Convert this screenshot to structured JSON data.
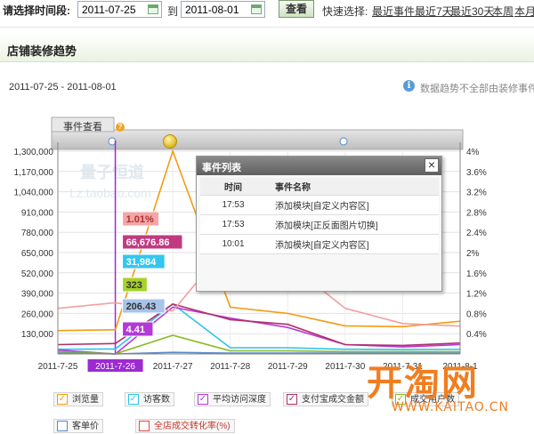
{
  "filter": {
    "label": "请选择时间段:",
    "start_date": "2011-07-25",
    "to_label": "到",
    "end_date": "2011-08-01",
    "query_button": "查看",
    "quick_label": "快速选择:",
    "quick_links": [
      "最近事件",
      "最近7天",
      "最近30天",
      "本周",
      "本月"
    ]
  },
  "panel": {
    "title": "店铺装修趋势",
    "date_range": "2011-07-25 - 2011-08-01",
    "note": "数据趋势不全部由装修事件"
  },
  "event_bar": {
    "label": "事件查看"
  },
  "watermark": {
    "text": "量子恒道",
    "url": "Lz.taobao.com"
  },
  "popup": {
    "title": "事件列表",
    "col_time": "时间",
    "col_name": "事件名称",
    "rows": [
      {
        "time": "17:53",
        "name": "添加模块[自定义内容区]"
      },
      {
        "time": "17:53",
        "name": "添加模块[正反面图片切换]"
      },
      {
        "time": "10:01",
        "name": "添加模块[自定义内容区]"
      }
    ]
  },
  "chart_data": {
    "type": "line",
    "x": [
      "2011-7-25",
      "2011-7-26",
      "2011-7-27",
      "2011-7-28",
      "2011-7-29",
      "2011-7-30",
      "2011-7-31",
      "2011-8-1"
    ],
    "selected_x": "2011-7-26",
    "ylim_left": [
      0,
      1300000
    ],
    "yticks_left": [
      "1,300,000",
      "1,170,000",
      "1,040,000",
      "910,000",
      "780,000",
      "650,000",
      "520,000",
      "390,000",
      "260,000",
      "130,000"
    ],
    "ylim_right": [
      0,
      4
    ],
    "yticks_right": [
      "4%",
      "3.6%",
      "3.2%",
      "2.8%",
      "2.4%",
      "2%",
      "1.6%",
      "1.2%",
      "0.8%",
      "0.4%"
    ],
    "series": [
      {
        "name": "浏览量",
        "color": "#f39c12",
        "axis": "left",
        "values": [
          150000,
          155000,
          1300000,
          300000,
          260000,
          180000,
          175000,
          210000
        ]
      },
      {
        "name": "访客数",
        "color": "#2ec4e6",
        "axis": "left",
        "values": [
          30000,
          31984,
          320000,
          40000,
          40000,
          30000,
          28000,
          30000
        ]
      },
      {
        "name": "平均访问深度",
        "color": "#b73ad6",
        "axis": "left",
        "values": [
          25000,
          4.41,
          300000,
          230000,
          170000,
          60000,
          45000,
          60000
        ]
      },
      {
        "name": "支付宝成交金额",
        "color": "#b0306a",
        "axis": "left",
        "values": [
          60000,
          66676.86,
          320000,
          220000,
          190000,
          60000,
          55000,
          70000
        ]
      },
      {
        "name": "成交用户数",
        "color": "#88bb22",
        "axis": "left",
        "values": [
          15000,
          323,
          120000,
          20000,
          20000,
          15000,
          15000,
          15000
        ]
      },
      {
        "name": "客单价",
        "color": "#5a88c8",
        "axis": "left",
        "values": [
          5000,
          206.43,
          10000,
          5000,
          5000,
          5000,
          5000,
          5000
        ]
      },
      {
        "name": "全店成交转化率(%)",
        "color": "#f2a0a0",
        "axis": "right",
        "values": [
          0.9,
          1.01,
          0.85,
          2.2,
          1.8,
          0.9,
          0.6,
          0.55
        ]
      }
    ],
    "point_labels": [
      {
        "text": "1.01%",
        "bg": "#f4a6a6",
        "color": "#b03030"
      },
      {
        "text": "66,676.86",
        "bg": "#c03a80",
        "color": "#ffffff"
      },
      {
        "text": "31,984",
        "bg": "#33c6ee",
        "color": "#ffffff"
      },
      {
        "text": "323",
        "bg": "#a6d22a",
        "color": "#333333"
      },
      {
        "text": "206.43",
        "bg": "#a9c4ea",
        "color": "#333333"
      },
      {
        "text": "4.41",
        "bg": "#b23ad6",
        "color": "#ffffff"
      }
    ],
    "legend": [
      {
        "label": "浏览量",
        "color": "#f39c12",
        "checked": true
      },
      {
        "label": "访客数",
        "color": "#2ec4e6",
        "checked": true
      },
      {
        "label": "平均访问深度",
        "color": "#b73ad6",
        "checked": true
      },
      {
        "label": "支付宝成交金额",
        "color": "#b0306a",
        "checked": true
      },
      {
        "label": "成交用户数",
        "color": "#88bb22",
        "checked": true
      },
      {
        "label": "客单价",
        "color": "#5a88c8",
        "checked": false
      },
      {
        "label": "全店成交转化率(%)",
        "color": "#e24a4a",
        "checked": false
      }
    ],
    "grid": true
  },
  "site_watermark": {
    "big": "开淘网",
    "url": "WWW.KAITAO.CN"
  }
}
